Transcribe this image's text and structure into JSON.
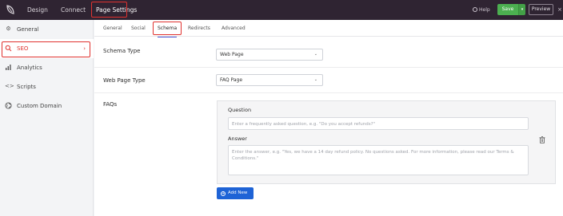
{
  "topbar": {
    "nav": [
      "Design",
      "Connect",
      "Page Settings"
    ],
    "help_label": "Help",
    "save_label": "Save",
    "save_caret": "▾",
    "preview_label": "Preview",
    "close_glyph": "×",
    "accent_red": "#e0322f",
    "save_green": "#4caf50"
  },
  "sidebar": {
    "items": [
      {
        "label": "General",
        "icon": "gear-icon"
      },
      {
        "label": "SEO",
        "icon": "search-icon",
        "active": true
      },
      {
        "label": "Analytics",
        "icon": "bar-chart-icon"
      },
      {
        "label": "Scripts",
        "icon": "code-icon"
      },
      {
        "label": "Custom Domain",
        "icon": "globe-icon"
      }
    ],
    "active_arrow": "›"
  },
  "tabs": [
    "General",
    "Social",
    "Schema",
    "Redirects",
    "Advanced"
  ],
  "active_tab": "Schema",
  "schema_type": {
    "label": "Schema Type",
    "value": "Web Page"
  },
  "web_page_type": {
    "label": "Web Page Type",
    "value": "FAQ Page"
  },
  "faqs": {
    "label": "FAQs",
    "question_label": "Question",
    "question_placeholder": "Enter a frequently asked question, e.g. \"Do you accept refunds?\"",
    "answer_label": "Answer",
    "answer_placeholder": "Enter the answer, e.g. \"Yes, we have a 14 day refund policy. No questions asked. For more information, please read our Terms & Conditions.\"",
    "add_label": "Add New"
  }
}
